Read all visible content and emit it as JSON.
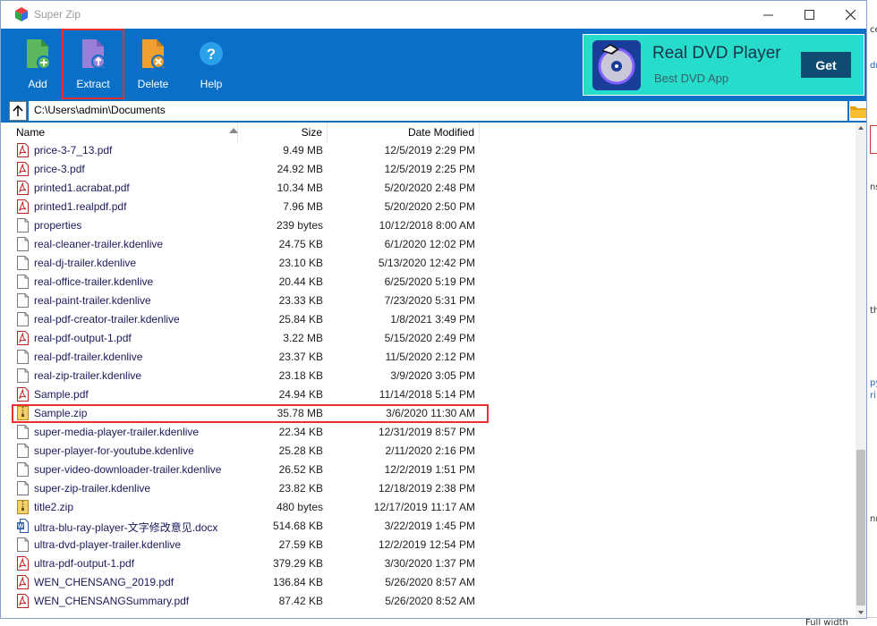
{
  "window": {
    "title": "Super Zip"
  },
  "toolbar": {
    "buttons": [
      {
        "label": "Add",
        "icon": "add-file-icon",
        "color": "#5cb85c"
      },
      {
        "label": "Extract",
        "icon": "extract-file-icon",
        "color": "#9a7fd8"
      },
      {
        "label": "Delete",
        "icon": "delete-file-icon",
        "color": "#f0a030"
      },
      {
        "label": "Help",
        "icon": "help-icon",
        "color": "#2aa0e8"
      }
    ]
  },
  "ad": {
    "title": "Real DVD Player",
    "subtitle": "Best DVD App",
    "button": "Get"
  },
  "address": {
    "path": "C:\\Users\\admin\\Documents"
  },
  "columns": {
    "name": "Name",
    "size": "Size",
    "date": "Date Modified"
  },
  "files": [
    {
      "name": "price-3-7_13.pdf",
      "size": "9.49 MB",
      "date": "12/5/2019 2:29 PM",
      "type": "pdf"
    },
    {
      "name": "price-3.pdf",
      "size": "24.92 MB",
      "date": "12/5/2019 2:25 PM",
      "type": "pdf"
    },
    {
      "name": "printed1.acrabat.pdf",
      "size": "10.34 MB",
      "date": "5/20/2020 2:48 PM",
      "type": "pdf"
    },
    {
      "name": "printed1.realpdf.pdf",
      "size": "7.96 MB",
      "date": "5/20/2020 2:50 PM",
      "type": "pdf"
    },
    {
      "name": "properties",
      "size": "239 bytes",
      "date": "10/12/2018 8:00 AM",
      "type": "file"
    },
    {
      "name": "real-cleaner-trailer.kdenlive",
      "size": "24.75 KB",
      "date": "6/1/2020 12:02 PM",
      "type": "file"
    },
    {
      "name": "real-dj-trailer.kdenlive",
      "size": "23.10 KB",
      "date": "5/13/2020 12:42 PM",
      "type": "file"
    },
    {
      "name": "real-office-trailer.kdenlive",
      "size": "20.44 KB",
      "date": "6/25/2020 5:19 PM",
      "type": "file"
    },
    {
      "name": "real-paint-trailer.kdenlive",
      "size": "23.33 KB",
      "date": "7/23/2020 5:31 PM",
      "type": "file"
    },
    {
      "name": "real-pdf-creator-trailer.kdenlive",
      "size": "25.84 KB",
      "date": "1/8/2021 3:49 PM",
      "type": "file"
    },
    {
      "name": "real-pdf-output-1.pdf",
      "size": "3.22 MB",
      "date": "5/15/2020 2:49 PM",
      "type": "pdf"
    },
    {
      "name": "real-pdf-trailer.kdenlive",
      "size": "23.37 KB",
      "date": "11/5/2020 2:12 PM",
      "type": "file"
    },
    {
      "name": "real-zip-trailer.kdenlive",
      "size": "23.18 KB",
      "date": "3/9/2020 3:05 PM",
      "type": "file"
    },
    {
      "name": "Sample.pdf",
      "size": "24.94 KB",
      "date": "11/14/2018 5:14 PM",
      "type": "pdf"
    },
    {
      "name": "Sample.zip",
      "size": "35.78 MB",
      "date": "3/6/2020 11:30 AM",
      "type": "zip",
      "highlighted": true
    },
    {
      "name": "super-media-player-trailer.kdenlive",
      "size": "22.34 KB",
      "date": "12/31/2019 8:57 PM",
      "type": "file"
    },
    {
      "name": "super-player-for-youtube.kdenlive",
      "size": "25.28 KB",
      "date": "2/11/2020 2:16 PM",
      "type": "file"
    },
    {
      "name": "super-video-downloader-trailer.kdenlive",
      "size": "26.52 KB",
      "date": "12/2/2019 1:51 PM",
      "type": "file"
    },
    {
      "name": "super-zip-trailer.kdenlive",
      "size": "23.82 KB",
      "date": "12/18/2019 2:38 PM",
      "type": "file"
    },
    {
      "name": "title2.zip",
      "size": "480 bytes",
      "date": "12/17/2019 11:17 AM",
      "type": "zip"
    },
    {
      "name": "ultra-blu-ray-player-文字修改意见.docx",
      "size": "514.68 KB",
      "date": "3/22/2019 1:45 PM",
      "type": "docx"
    },
    {
      "name": "ultra-dvd-player-trailer.kdenlive",
      "size": "27.59 KB",
      "date": "12/2/2019 12:54 PM",
      "type": "file"
    },
    {
      "name": "ultra-pdf-output-1.pdf",
      "size": "379.29 KB",
      "date": "3/30/2020 1:37 PM",
      "type": "pdf"
    },
    {
      "name": "WEN_CHENSANG_2019.pdf",
      "size": "136.84 KB",
      "date": "5/26/2020 8:57 AM",
      "type": "pdf"
    },
    {
      "name": "WEN_CHENSANGSummary.pdf",
      "size": "87.42 KB",
      "date": "5/26/2020 8:52 AM",
      "type": "pdf"
    }
  ],
  "background_window": {
    "fragments": [
      "ce",
      "dr",
      "ns",
      "th",
      "py",
      "ri",
      "nn"
    ],
    "bottom_text": "Full width"
  },
  "colors": {
    "toolbar": "#0a6fc6",
    "ad_bg": "#27dccb",
    "highlight": "#e8302c"
  }
}
